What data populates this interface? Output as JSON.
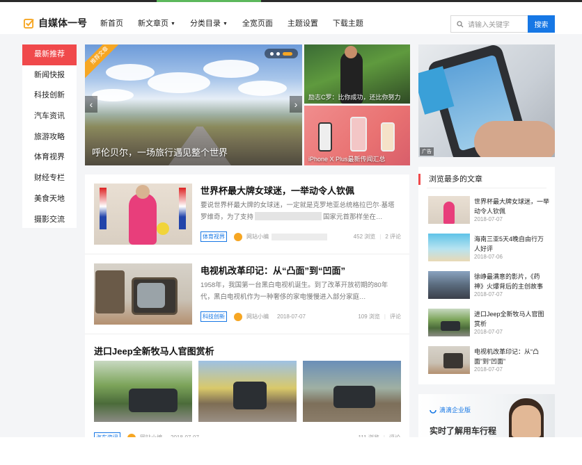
{
  "site": {
    "logo_text": "自媒体一号"
  },
  "nav": {
    "items": [
      {
        "label": "新首页"
      },
      {
        "label": "新文章页"
      },
      {
        "label": "分类目录"
      },
      {
        "label": "全宽页面"
      },
      {
        "label": "主题设置"
      },
      {
        "label": "下载主题"
      }
    ]
  },
  "search": {
    "placeholder": "请输入关键字",
    "button": "搜索"
  },
  "sidebar": {
    "items": [
      {
        "label": "最新推荐"
      },
      {
        "label": "新闻快报"
      },
      {
        "label": "科技创新"
      },
      {
        "label": "汽车资讯"
      },
      {
        "label": "旅游攻略"
      },
      {
        "label": "体育视界"
      },
      {
        "label": "财经专栏"
      },
      {
        "label": "美食天地"
      },
      {
        "label": "摄影交流"
      }
    ]
  },
  "slider": {
    "ribbon": "推荐文章",
    "title": "呼伦贝尔，一场旅行遇见整个世界",
    "prev": "‹",
    "next": "›"
  },
  "tiles": [
    {
      "caption": "励志C罗：比你成功，还比你努力"
    },
    {
      "caption": "iPhone X Plus最新传闻汇总"
    }
  ],
  "ad": {
    "tag": "广告"
  },
  "articles": [
    {
      "title": "世界杯最大牌女球迷，一举动令人钦佩",
      "desc": "要说世界杯最大牌的女球迷，一定就是克罗地亚总统格拉巴尔·基塔罗维奇，为了支持",
      "desc_tail": "国家元首那样坐在…",
      "category": "体育视界",
      "author": "网站小编",
      "views": "452 浏览",
      "comments": "2 评论"
    },
    {
      "title": "电视机改革印记：从“凸面”到“凹面”",
      "desc": "1958年，我国第一台黑白电视机诞生。到了改革开放初期的80年代，黑白电视机作为一种奢侈的家电慢慢进入部分家庭…",
      "category": "科技创新",
      "author": "网站小编",
      "date": "2018-07-07",
      "views": "109 浏览",
      "comments": "评论"
    }
  ],
  "gallery": {
    "title": "进口Jeep全新牧马人官图赏析",
    "category": "汽车资讯",
    "author": "网站小编",
    "date": "2018-07-07",
    "views": "111 浏览",
    "comments": "评论"
  },
  "popular": {
    "heading": "浏览最多的文章",
    "items": [
      {
        "title": "世界杯最大牌女球迷，一举动令人钦佩",
        "date": "2018-07-07"
      },
      {
        "title": "海南三亚5天4晚自由行万人好评",
        "date": "2018-07-06"
      },
      {
        "title": "徐峥最满意的影片，《药神》火爆背后的主创故事",
        "date": "2018-07-07"
      },
      {
        "title": "进口Jeep全新牧马人官图赏析",
        "date": "2018-07-07"
      },
      {
        "title": "电视机改革印记：从“凸面”到“凹面”",
        "date": "2018-07-07"
      }
    ]
  },
  "banner": {
    "brand": "滴滴企业版",
    "slogan": "实时了解用车行程"
  },
  "colors": {
    "accent": "#1677e5",
    "active": "#f0494b",
    "ribbon": "#f6a623"
  }
}
